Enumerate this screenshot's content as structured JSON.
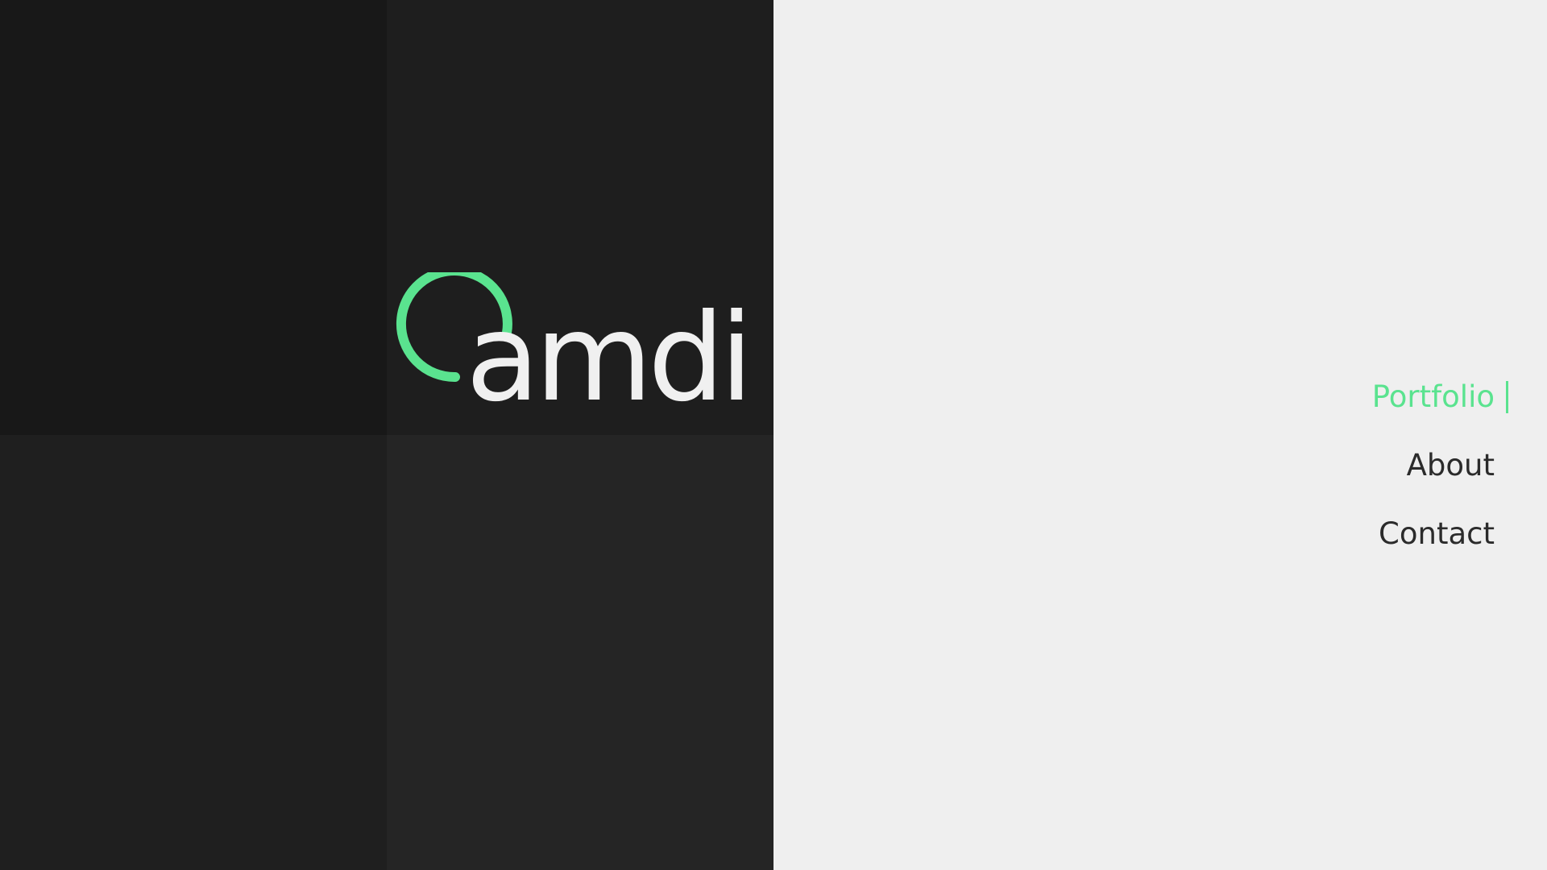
{
  "brand": {
    "name": "amdi",
    "accent_color": "#5ae38f",
    "text_color": "#f0f0f0",
    "icon": "open-ring-logo-mark"
  },
  "grid": {
    "tiles": [
      {
        "id": "top-left",
        "color": "#181818"
      },
      {
        "id": "top-right",
        "color": "#1e1e1e"
      },
      {
        "id": "bottom-left",
        "color": "#1f1f1f"
      },
      {
        "id": "bottom-right",
        "color": "#252525"
      }
    ]
  },
  "nav": {
    "items": [
      {
        "label": "Portfolio",
        "active": true
      },
      {
        "label": "About",
        "active": false
      },
      {
        "label": "Contact",
        "active": false
      }
    ],
    "active_color": "#5ae38f",
    "default_color": "#2b2b2b"
  },
  "background_color": "#efefef"
}
